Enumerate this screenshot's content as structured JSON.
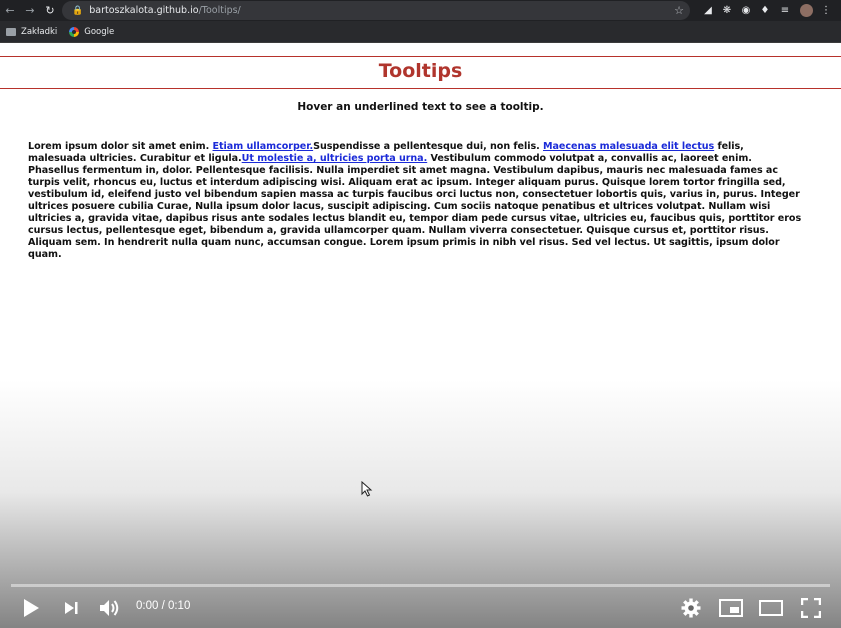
{
  "browser": {
    "url_host": "bartoszkalota.github.io",
    "url_path": "/Tooltips/",
    "bookmarks": [
      {
        "label": "Zakładki"
      },
      {
        "label": "Google"
      }
    ]
  },
  "page": {
    "title": "Tooltips",
    "subtitle": "Hover an underlined text to see a tooltip.",
    "paragraph": {
      "t1": "Lorem ipsum dolor sit amet enim. ",
      "link1": "Etiam ullamcorper.",
      "t2": "Suspendisse a pellentesque dui, non felis. ",
      "link2": "Maecenas malesuada elit lectus",
      "t3": " felis, malesuada ultricies. Curabitur et ligula.",
      "link3": "Ut molestie a, ultricies porta urna.",
      "t4": " Vestibulum commodo volutpat a, convallis ac, laoreet enim. Phasellus fermentum in, dolor. Pellentesque facilisis. Nulla imperdiet sit amet magna. Vestibulum dapibus, mauris nec malesuada fames ac turpis velit, rhoncus eu, luctus et interdum adipiscing wisi. Aliquam erat ac ipsum. Integer aliquam purus. Quisque lorem tortor fringilla sed, vestibulum id, eleifend justo vel bibendum sapien massa ac turpis faucibus orci luctus non, consectetuer lobortis quis, varius in, purus. Integer ultrices posuere cubilia Curae, Nulla ipsum dolor lacus, suscipit adipiscing. Cum sociis natoque penatibus et ultrices volutpat. Nullam wisi ultricies a, gravida vitae, dapibus risus ante sodales lectus blandit eu, tempor diam pede cursus vitae, ultricies eu, faucibus quis, porttitor eros cursus lectus, pellentesque eget, bibendum a, gravida ullamcorper quam. Nullam viverra consectetuer. Quisque cursus et, porttitor risus. Aliquam sem. In hendrerit nulla quam nunc, accumsan congue. Lorem ipsum primis in nibh vel risus. Sed vel lectus. Ut sagittis, ipsum dolor quam."
    }
  },
  "video": {
    "time_display": "0:00 / 0:10",
    "progress": 0.0
  },
  "colors": {
    "title_red": "#b0352d",
    "link_blue": "#1a2ad8"
  }
}
